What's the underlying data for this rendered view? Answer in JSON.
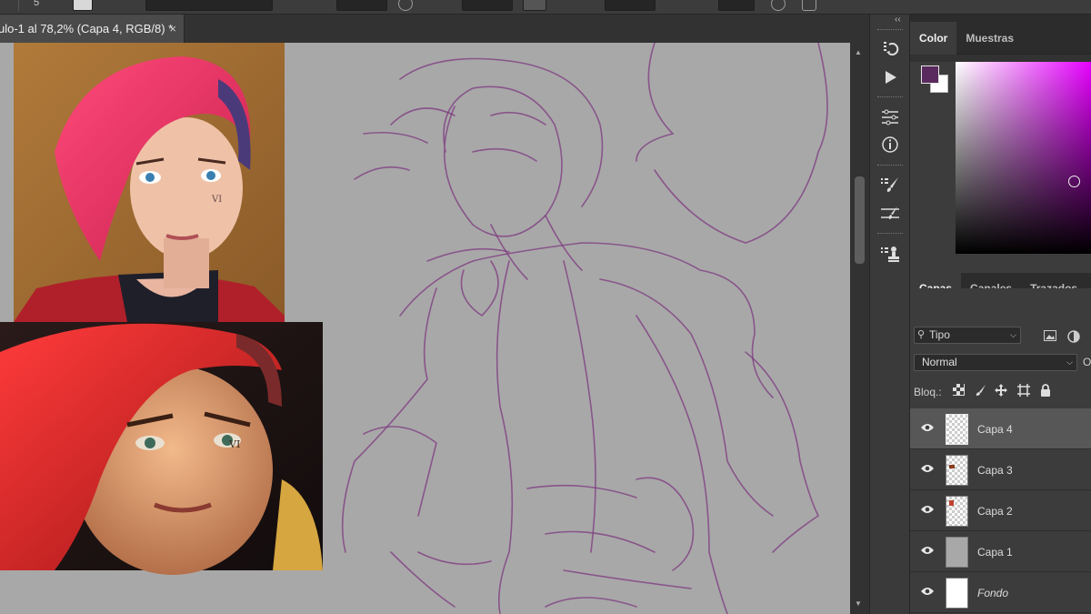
{
  "options_bar": {
    "brush_size": "5"
  },
  "document_tab": {
    "title": "ulo-1 al 78,2% (Capa 4, RGB/8) *",
    "close": "×"
  },
  "canvas": {
    "background": "#a8a8a8",
    "sketch_color": "#7d3a80",
    "reference_images": [
      "reference-portrait-top",
      "reference-portrait-bottom"
    ]
  },
  "tool_column": {
    "collapse": "‹‹",
    "buttons": [
      "history-icon",
      "play-icon",
      "adjustments-icon",
      "info-icon",
      "brush-settings-icon",
      "tool-presets-icon",
      "clone-source-icon"
    ]
  },
  "color_panel": {
    "tabs": [
      "Color",
      "Muestras"
    ],
    "active_tab": "Color",
    "foreground": "#5a2a5e",
    "background": "#ffffff",
    "hue": "#e600ff"
  },
  "layers_panel": {
    "tabs": [
      "Capas",
      "Canales",
      "Trazados"
    ],
    "active_tab": "Capas",
    "filter_label": "Tipo",
    "blend_mode": "Normal",
    "opacity_label": "O",
    "lock_label": "Bloq.:",
    "layers": [
      {
        "name": "Capa 4",
        "visible": true,
        "selected": true,
        "italic": false
      },
      {
        "name": "Capa 3",
        "visible": true,
        "selected": false,
        "italic": false
      },
      {
        "name": "Capa 2",
        "visible": true,
        "selected": false,
        "italic": false
      },
      {
        "name": "Capa 1",
        "visible": true,
        "selected": false,
        "italic": false
      },
      {
        "name": "Fondo",
        "visible": true,
        "selected": false,
        "italic": true
      }
    ]
  }
}
